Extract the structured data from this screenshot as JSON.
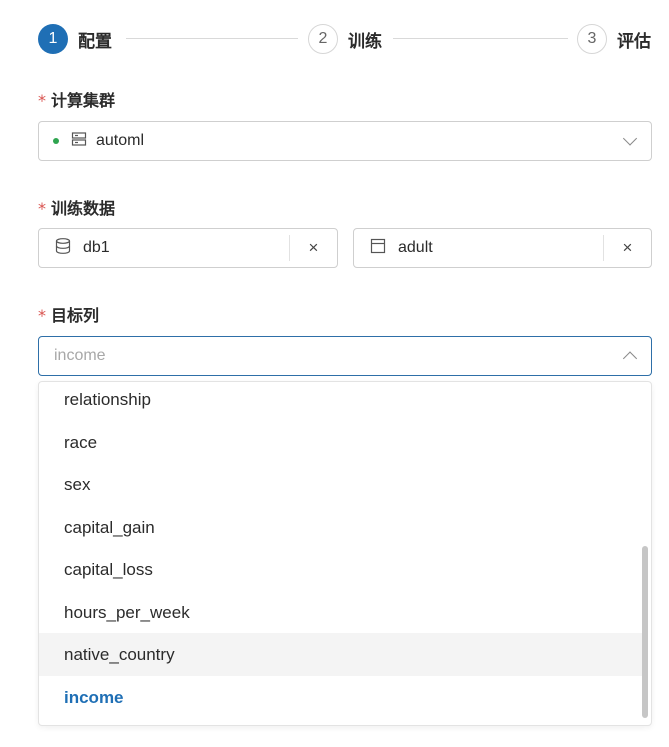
{
  "steps": [
    {
      "number": "1",
      "label": "配置",
      "state": "active"
    },
    {
      "number": "2",
      "label": "训练",
      "state": "inactive"
    },
    {
      "number": "3",
      "label": "评估",
      "state": "inactive"
    }
  ],
  "cluster": {
    "label": "计算集群",
    "required": "*",
    "value": "automl",
    "status_color": "#2ea44f",
    "icon": "server-icon"
  },
  "training_data": {
    "label": "训练数据",
    "required": "*",
    "database": {
      "value": "db1",
      "icon": "database-icon",
      "clear": "×"
    },
    "table": {
      "value": "adult",
      "icon": "table-icon",
      "clear": "×"
    }
  },
  "target": {
    "label": "目标列",
    "required": "*",
    "placeholder": "income",
    "options": [
      {
        "label": "relationship"
      },
      {
        "label": "race"
      },
      {
        "label": "sex"
      },
      {
        "label": "capital_gain"
      },
      {
        "label": "capital_loss"
      },
      {
        "label": "hours_per_week"
      },
      {
        "label": "native_country",
        "hovered": true
      },
      {
        "label": "income",
        "selected": true
      }
    ]
  },
  "colors": {
    "accent": "#1f6fb5",
    "required": "#d9534f",
    "status_ok": "#2ea44f"
  }
}
